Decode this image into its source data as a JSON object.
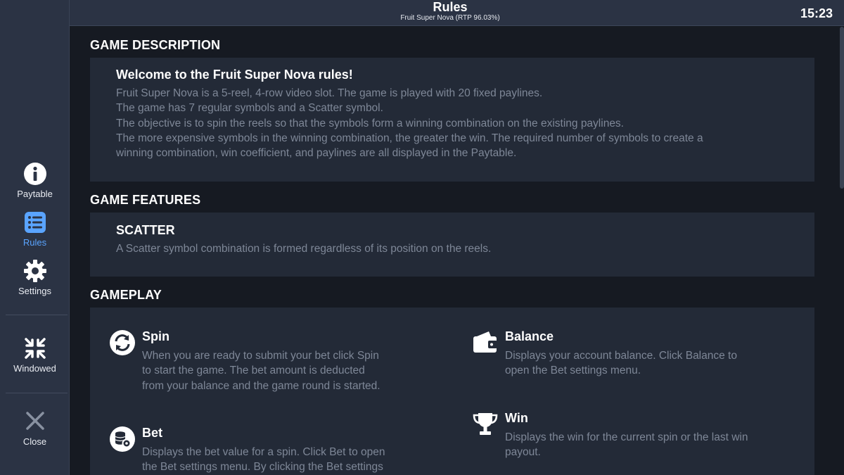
{
  "header": {
    "title": "Rules",
    "subtitle": "Fruit Super Nova (RTP 96.03%)",
    "clock": "15:23"
  },
  "sidebar": {
    "items": [
      {
        "label": "Paytable",
        "icon": "info-icon"
      },
      {
        "label": "Rules",
        "icon": "list-icon",
        "active": true
      },
      {
        "label": "Settings",
        "icon": "gear-icon"
      },
      {
        "label": "Windowed",
        "icon": "collapse-icon"
      },
      {
        "label": "Close",
        "icon": "close-icon"
      }
    ]
  },
  "sections": {
    "description": {
      "title": "GAME DESCRIPTION",
      "heading": "Welcome to the Fruit Super Nova rules!",
      "lines": [
        "Fruit Super Nova is a 5-reel, 4-row video slot. The game is played with 20 fixed paylines.",
        "The game has 7 regular symbols and a Scatter symbol.",
        "The objective is to spin the reels so that the symbols form a winning combination on the existing paylines.",
        "The more expensive symbols in the winning combination, the greater the win. The required number of symbols to create a",
        "winning combination, win coefficient, and paylines are all displayed in the Paytable."
      ]
    },
    "features": {
      "title": "GAME FEATURES",
      "heading": "SCATTER",
      "text": "A Scatter symbol combination is formed regardless of its position on the reels."
    },
    "gameplay": {
      "title": "GAMEPLAY",
      "items": [
        {
          "title": "Spin",
          "icon": "spin-icon",
          "lines": [
            "When you are ready to submit your bet click Spin",
            "to start the game. The bet amount is deducted",
            "from your balance and the game round is started."
          ]
        },
        {
          "title": "Balance",
          "icon": "wallet-icon",
          "lines": [
            "Displays your account balance. Click Balance to",
            "open the Bet settings menu."
          ]
        },
        {
          "title": "Bet",
          "icon": "bet-icon",
          "lines": [
            "Displays the bet value for a spin. Click Bet to open",
            "the Bet settings menu. By clicking the Bet settings"
          ]
        },
        {
          "title": "Win",
          "icon": "trophy-icon",
          "lines": [
            "Displays the win for the current spin or the last win",
            "payout."
          ]
        }
      ]
    }
  }
}
